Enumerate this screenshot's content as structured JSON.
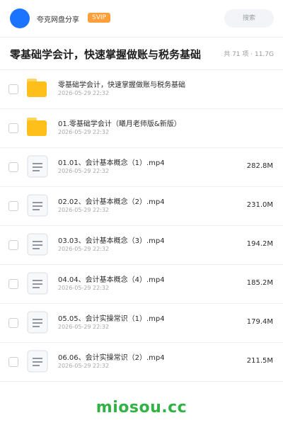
{
  "header": {
    "app_name": "夸克网盘分享",
    "badge": "SVIP",
    "search_placeholder": "搜索"
  },
  "folder": {
    "title": "零基础学会计，快速掌握做账与税务基础",
    "meta": "共 71 项 · 11.7G"
  },
  "files": [
    {
      "type": "folder",
      "name": "零基础学会计，快速掌握做账与税务基础",
      "date": "2026-05-29 22:32",
      "size": ""
    },
    {
      "type": "folder",
      "name": "01.零基础学会计（曦月老师版&新版）",
      "date": "2026-05-29 22:32",
      "size": ""
    },
    {
      "type": "video",
      "name": "01.01、会计基本概念（1）.mp4",
      "date": "2026-05-29 22:32",
      "size": "282.8M"
    },
    {
      "type": "video",
      "name": "02.02、会计基本概念（2）.mp4",
      "date": "2026-05-29 22:32",
      "size": "231.0M"
    },
    {
      "type": "video",
      "name": "03.03、会计基本概念（3）.mp4",
      "date": "2026-05-29 22:32",
      "size": "194.2M"
    },
    {
      "type": "video",
      "name": "04.04、会计基本概念（4）.mp4",
      "date": "2026-05-29 22:32",
      "size": "185.2M"
    },
    {
      "type": "video",
      "name": "05.05、会计实操常识（1）.mp4",
      "date": "2026-05-29 22:32",
      "size": "179.4M"
    },
    {
      "type": "video",
      "name": "06.06、会计实操常识（2）.mp4",
      "date": "2026-05-29 22:32",
      "size": "211.5M"
    }
  ],
  "watermark": "miosou.cc",
  "colors": {
    "avatar": "#1a74ff",
    "badge": "#ff9f3a",
    "folder": "#ffbf1a",
    "watermark": "#32b145"
  }
}
